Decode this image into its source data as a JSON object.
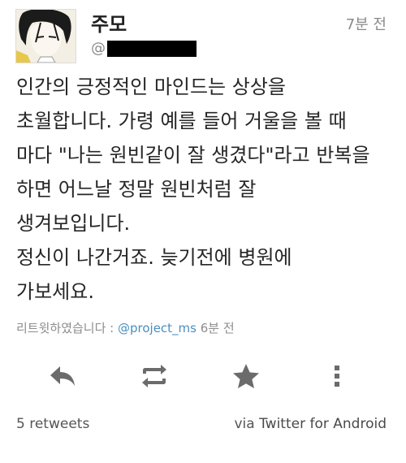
{
  "tweet": {
    "author_name": "주모",
    "handle_prefix": "@",
    "time_ago": "7분 전",
    "text_lines": [
      "인간의 긍정적인 마인드는 상상을",
      "초월합니다. 가령 예를 들어 거울을 볼 때",
      "마다 \"나는 원빈같이 잘 생겼다\"라고 반복을",
      "하면 어느날 정말 원빈처럼 잘",
      "생겨보입니다.",
      "정신이 나간거죠. 늦기전에 병원에",
      "가보세요."
    ]
  },
  "retweet": {
    "prefix": "리트윗하였습니다 : ",
    "user": "@project_ms",
    "time_ago": " 6분 전"
  },
  "actions": {
    "icons": [
      "reply-icon",
      "retweet-icon",
      "favorite-star-icon",
      "more-vertical-icon"
    ]
  },
  "footer": {
    "retweet_count": "5",
    "retweet_label": " retweets",
    "via": "via ",
    "app": "Twitter for Android"
  },
  "colors": {
    "link": "#4a8fbe",
    "icon": "#6b6b6b",
    "muted": "#8a8a8a"
  }
}
